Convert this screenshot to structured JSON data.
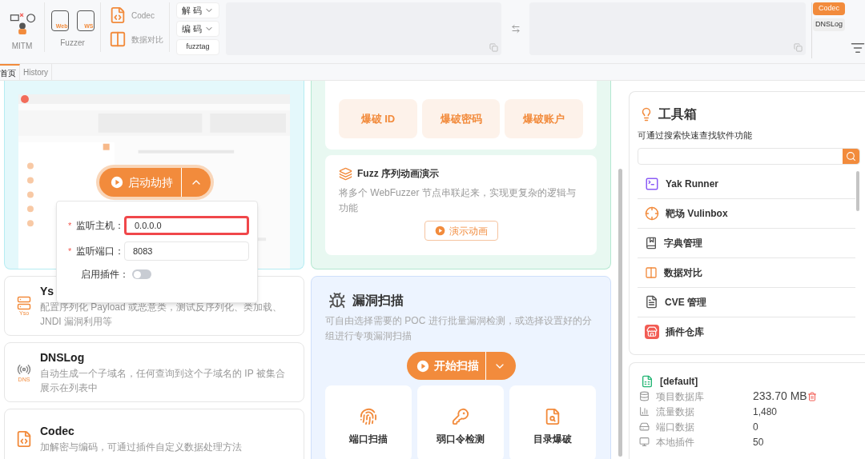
{
  "toolbar": {
    "mitm_label": "MITM",
    "fuzzer": {
      "label": "Fuzzer",
      "items": [
        "Web",
        "WS"
      ]
    },
    "codec_tools": [
      "Codec",
      "数据对比"
    ],
    "selects": [
      "解 码",
      "编 码"
    ],
    "fuzztag_button": "fuzztag"
  },
  "side_tabs": [
    {
      "label": "Codec",
      "selected": true
    },
    {
      "label": "DNSLog",
      "selected": false
    }
  ],
  "page_tabs": [
    {
      "label": "首页",
      "selected": true
    },
    {
      "label": "History",
      "selected": false
    }
  ],
  "mitm_card": {
    "start_button": "启动劫持",
    "fields": [
      {
        "required_mark": "*",
        "label": "监听主机：",
        "value": "0.0.0.0",
        "highlighted": true
      },
      {
        "required_mark": "*",
        "label": "监听端口：",
        "value": "8083",
        "highlighted": false
      }
    ],
    "plugin_label": "启用插件：",
    "plugin_on": false
  },
  "tool_cards": [
    {
      "kind": "yso",
      "icon_tag": "Yso",
      "title": "Ys",
      "description": "配置序列化 Payload 或恶意类，测试反序列化、类加载、JNDI 漏洞利用等"
    },
    {
      "kind": "dns",
      "icon_tag": "DNS",
      "title": "DNSLog",
      "description": "自动生成一个子域名，任何查询到这个子域名的 IP 被集合展示在列表中"
    },
    {
      "kind": "codec",
      "title": "Codec",
      "description": "加解密与编码，可通过插件自定义数据处理方法"
    }
  ],
  "brute_buttons": [
    "爆破 ID",
    "爆破密码",
    "爆破账户"
  ],
  "fuzz_card": {
    "title": "Fuzz 序列动画演示",
    "description": "将多个 WebFuzzer 节点串联起来，实现更复杂的逻辑与功能",
    "button": "演示动画"
  },
  "vuln_scan": {
    "title": "漏洞扫描",
    "description": "可自由选择需要的 POC 进行批量漏洞检测，或选择设置好的分组进行专项漏洞扫描",
    "start_button": "开始扫描",
    "tools": [
      {
        "kind": "port",
        "label": "端口扫描"
      },
      {
        "kind": "weak",
        "label": "弱口令检测"
      },
      {
        "kind": "dir",
        "label": "目录爆破"
      }
    ]
  },
  "toolbox": {
    "title": "工具箱",
    "subtitle": "可通过搜索快速查找软件功能",
    "items": [
      {
        "kind": "runner",
        "label": "Yak Runner"
      },
      {
        "kind": "target",
        "label": "靶场 Vulinbox"
      },
      {
        "kind": "dict",
        "label": "字典管理"
      },
      {
        "kind": "compare",
        "label": "数据对比"
      },
      {
        "kind": "cve",
        "label": "CVE 管理"
      },
      {
        "kind": "store",
        "label": "插件仓库"
      }
    ]
  },
  "project": {
    "name": "[default]",
    "stats": [
      {
        "kind": "db",
        "label": "项目数据库",
        "value": "233.70 MB"
      },
      {
        "kind": "traffic",
        "label": "流量数据",
        "value": "1,480"
      },
      {
        "kind": "port",
        "label": "端口数据",
        "value": "0"
      },
      {
        "kind": "plugin",
        "label": "本地插件",
        "value": "50"
      }
    ]
  }
}
